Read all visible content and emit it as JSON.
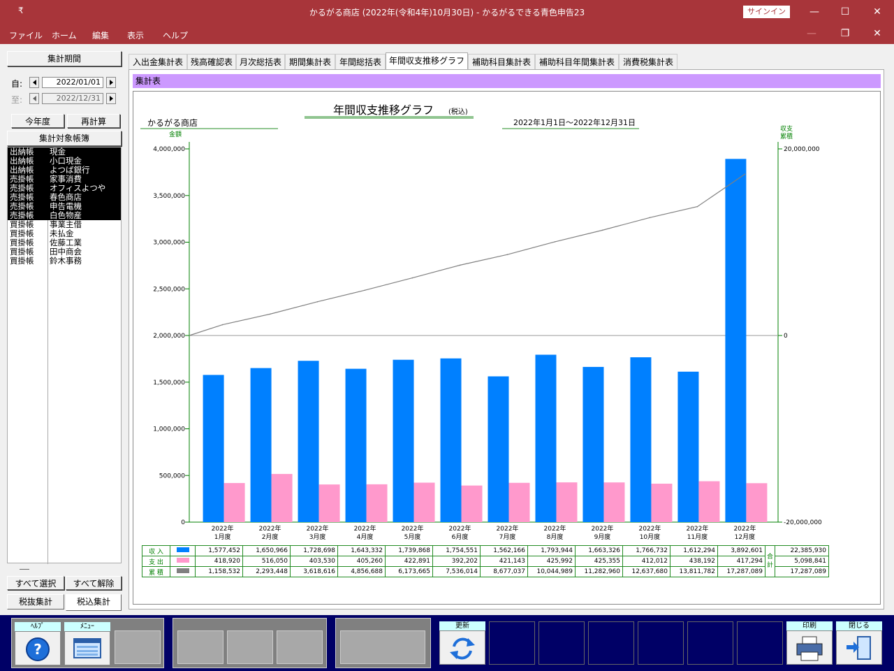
{
  "window": {
    "title": "かるがる商店 (2022年(令和4年)10月30日)  -  かるがるできる青色申告23",
    "signin": "サインイン",
    "quick_access": "₹"
  },
  "menu": {
    "items": [
      "ファイル",
      "ホーム",
      "編集",
      "表示",
      "ヘルプ"
    ]
  },
  "left": {
    "period_title": "集計期間",
    "from_label": "自:",
    "from_date": "2022/01/01",
    "to_label": "至:",
    "to_date": "2022/12/31",
    "this_year": "今年度",
    "recalc": "再計算",
    "books_title": "集計対象帳簿",
    "books": [
      {
        "type": "出納帳",
        "name": "現金",
        "selected": true
      },
      {
        "type": "出納帳",
        "name": "小口現金",
        "selected": true
      },
      {
        "type": "出納帳",
        "name": "よつば銀行",
        "selected": true
      },
      {
        "type": "売掛帳",
        "name": "家事消費",
        "selected": true
      },
      {
        "type": "売掛帳",
        "name": "オフィスよつや",
        "selected": true
      },
      {
        "type": "売掛帳",
        "name": "春色商店",
        "selected": true
      },
      {
        "type": "売掛帳",
        "name": "申告電機",
        "selected": true
      },
      {
        "type": "売掛帳",
        "name": "白色物産",
        "selected": true
      },
      {
        "type": "買掛帳",
        "name": "事業主借",
        "selected": false
      },
      {
        "type": "買掛帳",
        "name": "未払金",
        "selected": false
      },
      {
        "type": "買掛帳",
        "name": "佐藤工業",
        "selected": false
      },
      {
        "type": "買掛帳",
        "name": "田中商会",
        "selected": false
      },
      {
        "type": "買掛帳",
        "name": "鈴木事務",
        "selected": false
      }
    ],
    "select_all": "すべて選択",
    "deselect_all": "すべて解除",
    "tax_excl": "税抜集計",
    "tax_incl": "税込集計"
  },
  "tabs": [
    "入出金集計表",
    "残高確認表",
    "月次総括表",
    "期間集計表",
    "年間総括表",
    "年間収支推移グラフ",
    "補助科目集計表",
    "補助科目年間集計表",
    "消費税集計表"
  ],
  "active_tab": 5,
  "section_title": "集計表",
  "chart_data": {
    "type": "bar",
    "title": "年間収支推移グラフ",
    "title_suffix": "(税込)",
    "company": "かるがる商店",
    "period": "2022年1月1日〜2022年12月31日",
    "ylabel": "金額",
    "y2label_1": "収支",
    "y2label_2": "累積",
    "ylim": [
      0,
      4000000
    ],
    "y_ticks": [
      "4,000,000",
      "3,500,000",
      "3,000,000",
      "2,500,000",
      "2,000,000",
      "1,500,000",
      "1,000,000",
      "500,000",
      "0"
    ],
    "y2lim": [
      -20000000,
      20000000
    ],
    "y2_ticks": [
      "20,000,000",
      "0",
      "-20,000,000"
    ],
    "categories": [
      [
        "2022年",
        "1月度"
      ],
      [
        "2022年",
        "2月度"
      ],
      [
        "2022年",
        "3月度"
      ],
      [
        "2022年",
        "4月度"
      ],
      [
        "2022年",
        "5月度"
      ],
      [
        "2022年",
        "6月度"
      ],
      [
        "2022年",
        "7月度"
      ],
      [
        "2022年",
        "8月度"
      ],
      [
        "2022年",
        "9月度"
      ],
      [
        "2022年",
        "10月度"
      ],
      [
        "2022年",
        "11月度"
      ],
      [
        "2022年",
        "12月度"
      ]
    ],
    "series": [
      {
        "name": "収入",
        "color": "#0080ff",
        "values": [
          1577452,
          1650966,
          1728698,
          1643332,
          1739868,
          1754551,
          1562166,
          1793944,
          1663326,
          1766732,
          1612294,
          3892601
        ]
      },
      {
        "name": "支出",
        "color": "#ff99cc",
        "values": [
          418920,
          516050,
          403530,
          405260,
          422891,
          392202,
          421143,
          425992,
          425355,
          412012,
          438192,
          417294
        ]
      },
      {
        "name": "累積",
        "color": "#808080",
        "values": [
          1158532,
          2293448,
          3618616,
          4856688,
          6173665,
          7536014,
          8677037,
          10044989,
          11282960,
          12637680,
          13811782,
          17287089
        ]
      }
    ]
  },
  "table": {
    "row_labels": [
      "収 入",
      "支 出",
      "累 積"
    ],
    "total_label_1": "合",
    "total_label_2": "計",
    "rows": [
      [
        "1,577,452",
        "1,650,966",
        "1,728,698",
        "1,643,332",
        "1,739,868",
        "1,754,551",
        "1,562,166",
        "1,793,944",
        "1,663,326",
        "1,766,732",
        "1,612,294",
        "3,892,601"
      ],
      [
        "418,920",
        "516,050",
        "403,530",
        "405,260",
        "422,891",
        "392,202",
        "421,143",
        "425,992",
        "425,355",
        "412,012",
        "438,192",
        "417,294"
      ],
      [
        "1,158,532",
        "2,293,448",
        "3,618,616",
        "4,856,688",
        "6,173,665",
        "7,536,014",
        "8,677,037",
        "10,044,989",
        "11,282,960",
        "12,637,680",
        "13,811,782",
        "17,287,089"
      ]
    ],
    "totals": [
      "22,385,930",
      "5,098,841",
      "17,287,089"
    ]
  },
  "fkeys": {
    "help": "ﾍﾙﾌﾟ",
    "menu": "ﾒﾆｭｰ",
    "refresh": "更新",
    "print": "印刷",
    "close": "閉じる"
  }
}
